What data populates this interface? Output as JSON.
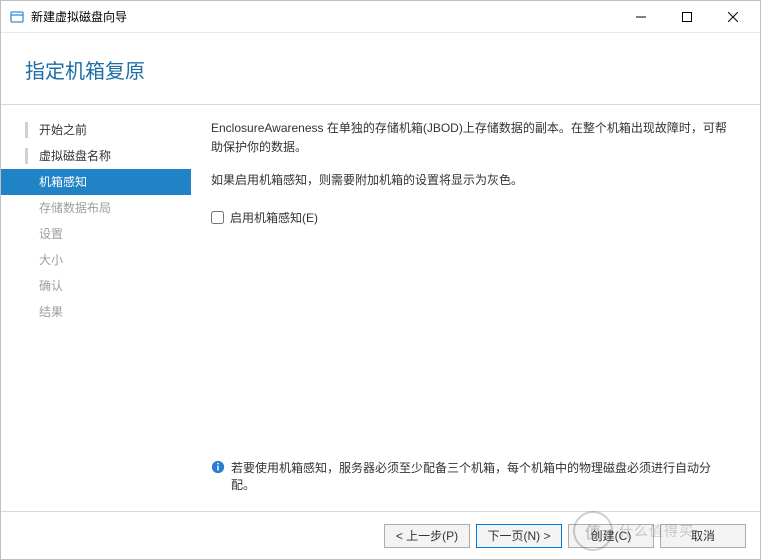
{
  "window": {
    "title": "新建虚拟磁盘向导"
  },
  "header": {
    "heading": "指定机箱复原"
  },
  "nav": {
    "items": [
      {
        "label": "开始之前",
        "state": "done"
      },
      {
        "label": "虚拟磁盘名称",
        "state": "done"
      },
      {
        "label": "机箱感知",
        "state": "active"
      },
      {
        "label": "存储数据布局",
        "state": "pending"
      },
      {
        "label": "设置",
        "state": "pending"
      },
      {
        "label": "大小",
        "state": "pending"
      },
      {
        "label": "确认",
        "state": "pending"
      },
      {
        "label": "结果",
        "state": "pending"
      }
    ]
  },
  "content": {
    "desc1": "EnclosureAwareness 在单独的存储机箱(JBOD)上存储数据的副本。在整个机箱出现故障时，可帮助保护你的数据。",
    "desc2": "如果启用机箱感知，则需要附加机箱的设置将显示为灰色。",
    "checkbox_label": "启用机箱感知(E)",
    "checkbox_checked": false,
    "info_text": "若要使用机箱感知，服务器必须至少配备三个机箱，每个机箱中的物理磁盘必须进行自动分配。"
  },
  "footer": {
    "prev": "< 上一步(P)",
    "next": "下一页(N) >",
    "create": "创建(C)",
    "cancel": "取消"
  },
  "watermark": {
    "circle": "值",
    "text": "什么值得买"
  }
}
